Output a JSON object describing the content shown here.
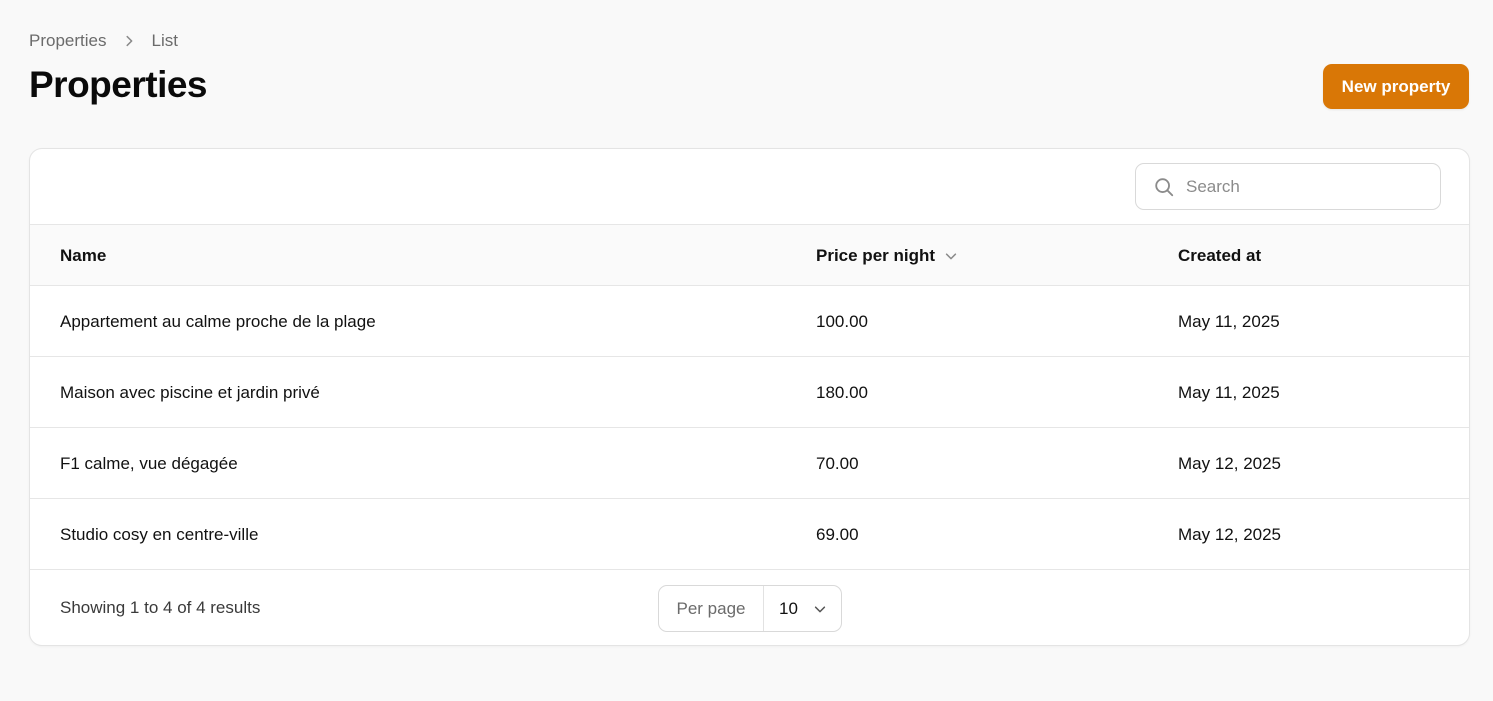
{
  "breadcrumb": {
    "items": [
      "Properties",
      "List"
    ]
  },
  "page": {
    "title": "Properties",
    "new_button_label": "New property"
  },
  "search": {
    "placeholder": "Search",
    "value": ""
  },
  "table": {
    "columns": [
      {
        "label": "Name"
      },
      {
        "label": "Price per night",
        "sorted": "desc"
      },
      {
        "label": "Created at"
      }
    ],
    "rows": [
      {
        "name": "Appartement au calme proche de la plage",
        "price": "100.00",
        "created_at": "May 11, 2025"
      },
      {
        "name": "Maison avec piscine et jardin privé",
        "price": "180.00",
        "created_at": "May 11, 2025"
      },
      {
        "name": "F1 calme, vue dégagée",
        "price": "70.00",
        "created_at": "May 12, 2025"
      },
      {
        "name": "Studio cosy en centre-ville",
        "price": "69.00",
        "created_at": "May 12, 2025"
      }
    ]
  },
  "pagination": {
    "summary": "Showing 1 to 4 of 4 results",
    "per_page_label": "Per page",
    "per_page_value": "10"
  },
  "icons": {
    "breadcrumb_separator": "chevron-right-icon",
    "search": "search-icon",
    "sort": "chevron-down-icon",
    "select": "chevron-down-icon"
  },
  "colors": {
    "accent": "#d97706",
    "background": "#f9f9f9"
  }
}
